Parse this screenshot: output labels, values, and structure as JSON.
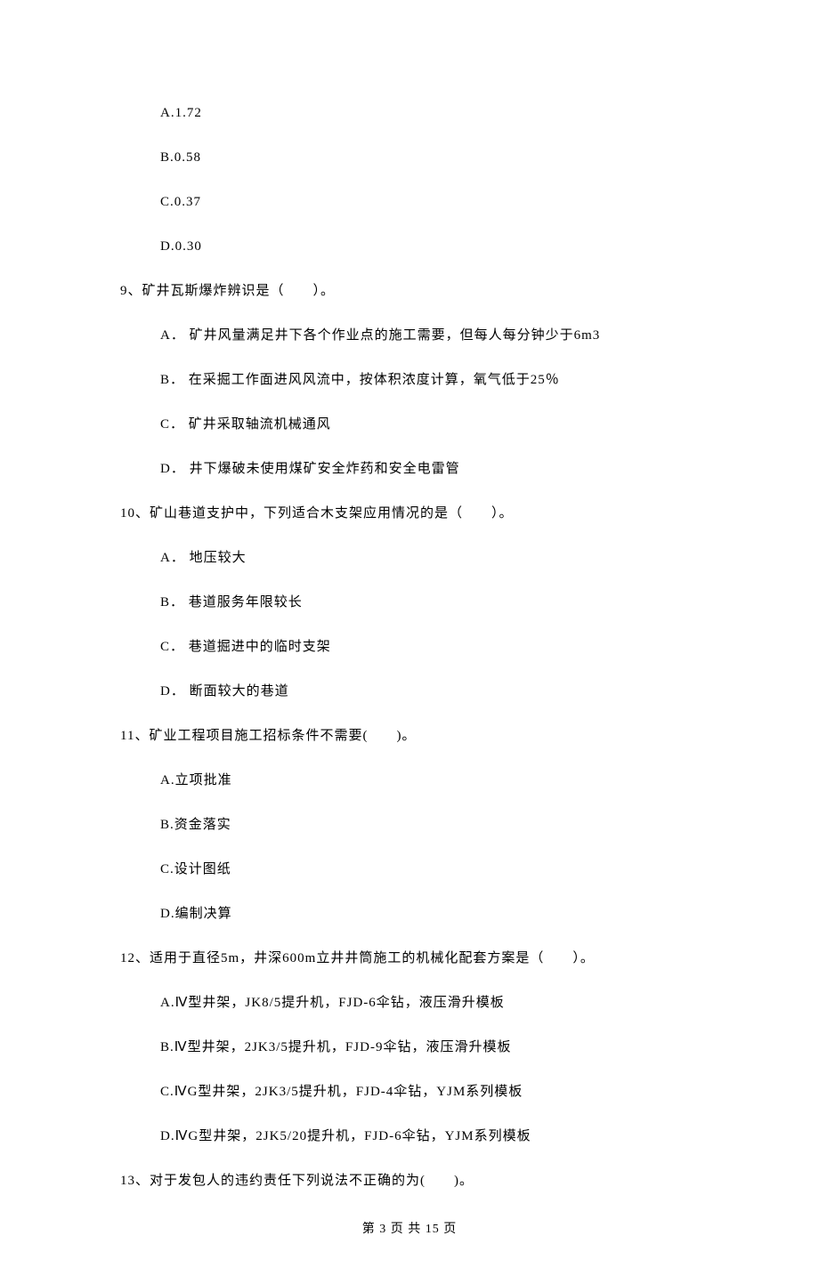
{
  "q8_options": {
    "a": "A.1.72",
    "b": "B.0.58",
    "c": "C.0.37",
    "d": "D.0.30"
  },
  "q9": {
    "stem": "9、矿井瓦斯爆炸辨识是（　　）。",
    "a": "A． 矿井风量满足井下各个作业点的施工需要，但每人每分钟少于6m3",
    "b": "B． 在采掘工作面进风风流中，按体积浓度计算，氧气低于25％",
    "c": "C． 矿井采取轴流机械通风",
    "d": "D． 井下爆破未使用煤矿安全炸药和安全电雷管"
  },
  "q10": {
    "stem": "10、矿山巷道支护中，下列适合木支架应用情况的是（　　）。",
    "a": "A． 地压较大",
    "b": "B． 巷道服务年限较长",
    "c": "C． 巷道掘进中的临时支架",
    "d": "D． 断面较大的巷道"
  },
  "q11": {
    "stem": "11、矿业工程项目施工招标条件不需要(　　)。",
    "a": "A.立项批准",
    "b": "B.资金落实",
    "c": "C.设计图纸",
    "d": "D.编制决算"
  },
  "q12": {
    "stem": "12、适用于直径5m，井深600m立井井筒施工的机械化配套方案是（　　）。",
    "a": "A.Ⅳ型井架，JK8/5提升机，FJD‐6伞钻，液压滑升模板",
    "b": "B.Ⅳ型井架，2JK3/5提升机，FJD‐9伞钻，液压滑升模板",
    "c": "C.ⅣG型井架，2JK3/5提升机，FJD‐4伞钻，YJM系列模板",
    "d": "D.ⅣG型井架，2JK5/20提升机，FJD‐6伞钻，YJM系列模板"
  },
  "q13": {
    "stem": "13、对于发包人的违约责任下列说法不正确的为(　　)。"
  },
  "footer": "第 3 页 共 15 页"
}
